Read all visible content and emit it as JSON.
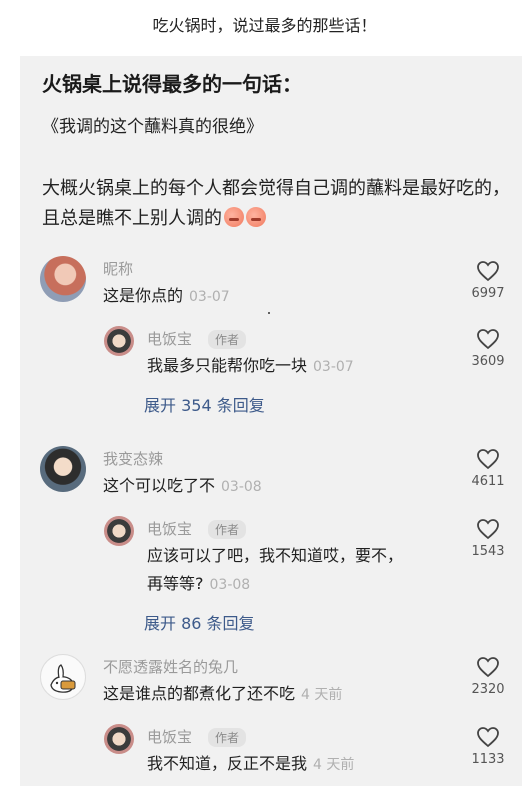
{
  "caption": "吃火锅时，说过最多的那些话！",
  "post": {
    "title": "火锅桌上说得最多的一句话：",
    "quote": "《我调的这个蘸料真的很绝》",
    "body": "大概火锅桌上的每个人都会觉得自己调的蘸料是最好吃的，且总是瞧不上别人调的"
  },
  "comments": [
    {
      "user": "昵称",
      "text": "这是你点的",
      "date": "03-07",
      "likes": "6997",
      "reply": {
        "user": "电饭宝",
        "tag": "作者",
        "text": "我最多只能帮你吃一块",
        "date": "03-07",
        "likes": "3609"
      },
      "expand": "展开 354 条回复"
    },
    {
      "user": "我变态辣",
      "text": "这个可以吃了不",
      "date": "03-08",
      "likes": "4611",
      "reply": {
        "user": "电饭宝",
        "tag": "作者",
        "text": "应该可以了吧，我不知道哎，要不，",
        "text2": "再等等?",
        "date": "03-08",
        "likes": "1543"
      },
      "expand": "展开 86 条回复"
    },
    {
      "user": "不愿透露姓名的兔几",
      "text": "这是谁点的都煮化了还不吃",
      "date": "4 天前",
      "likes": "2320",
      "reply": {
        "user": "电饭宝",
        "tag": "作者",
        "text": "我不知道，反正不是我",
        "date": "4 天前",
        "likes": "1133"
      }
    }
  ]
}
